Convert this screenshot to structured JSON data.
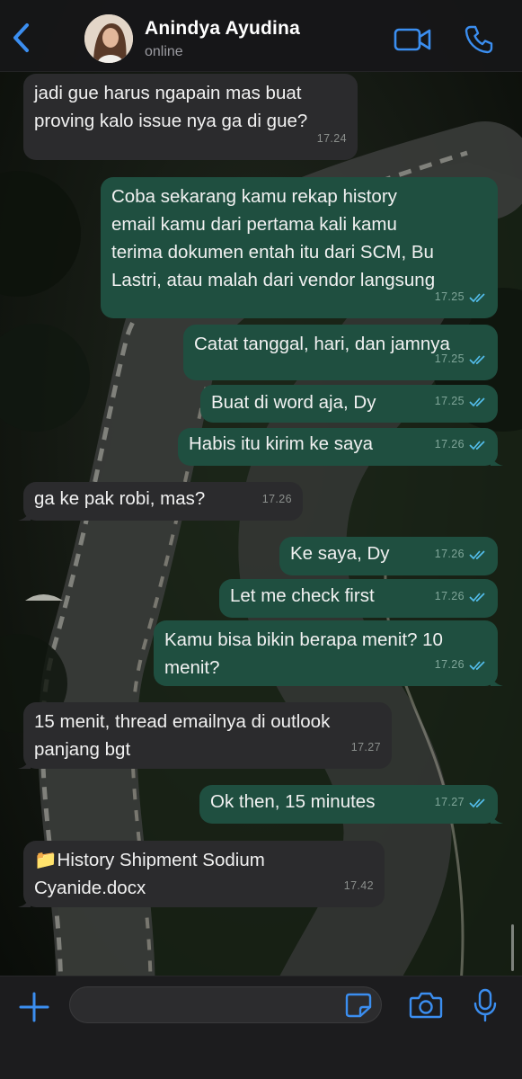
{
  "header": {
    "contact_name": "Anindya Ayudina",
    "status": "online",
    "back_icon": "chevron-left-icon",
    "video_icon": "video-camera-icon",
    "call_icon": "phone-icon"
  },
  "colors": {
    "accent": "#3b8ef0",
    "incoming_bubble": "#2b2b2d",
    "outgoing_bubble": "#1f4f40",
    "read_ticks": "#53bdeb"
  },
  "messages": [
    {
      "direction": "incoming",
      "text": "jadi gue harus ngapain mas buat\nproving kalo issue nya ga di gue?",
      "time": "17.24"
    },
    {
      "direction": "outgoing",
      "text": "Coba sekarang kamu rekap history\nemail kamu dari pertama kali kamu\nterima dokumen entah itu dari SCM, Bu\nLastri, atau malah dari vendor langsung",
      "time": "17.25",
      "read": true
    },
    {
      "direction": "outgoing",
      "text": "Catat tanggal, hari, dan jamnya",
      "time": "17.25",
      "read": true
    },
    {
      "direction": "outgoing",
      "text": "Buat di word aja, Dy",
      "time": "17.25",
      "read": true
    },
    {
      "direction": "outgoing",
      "text": "Habis itu kirim ke saya",
      "time": "17.26",
      "read": true
    },
    {
      "direction": "incoming",
      "text": "ga ke pak robi, mas?",
      "time": "17.26"
    },
    {
      "direction": "outgoing",
      "text": "Ke saya, Dy",
      "time": "17.26",
      "read": true
    },
    {
      "direction": "outgoing",
      "text": "Let me check first",
      "time": "17.26",
      "read": true
    },
    {
      "direction": "outgoing",
      "text": "Kamu bisa bikin berapa menit? 10\nmenit?",
      "time": "17.26",
      "read": true
    },
    {
      "direction": "incoming",
      "text": "15 menit, thread emailnya di outlook\npanjang bgt",
      "time": "17.27"
    },
    {
      "direction": "outgoing",
      "text": "Ok then, 15 minutes",
      "time": "17.27",
      "read": true
    },
    {
      "direction": "incoming",
      "text": "📁History Shipment Sodium\nCyanide.docx",
      "time": "17.42"
    }
  ],
  "composer": {
    "input_value": "",
    "plus_icon": "plus-icon",
    "sticker_icon": "sticker-icon",
    "camera_icon": "camera-icon",
    "mic_icon": "microphone-icon"
  }
}
